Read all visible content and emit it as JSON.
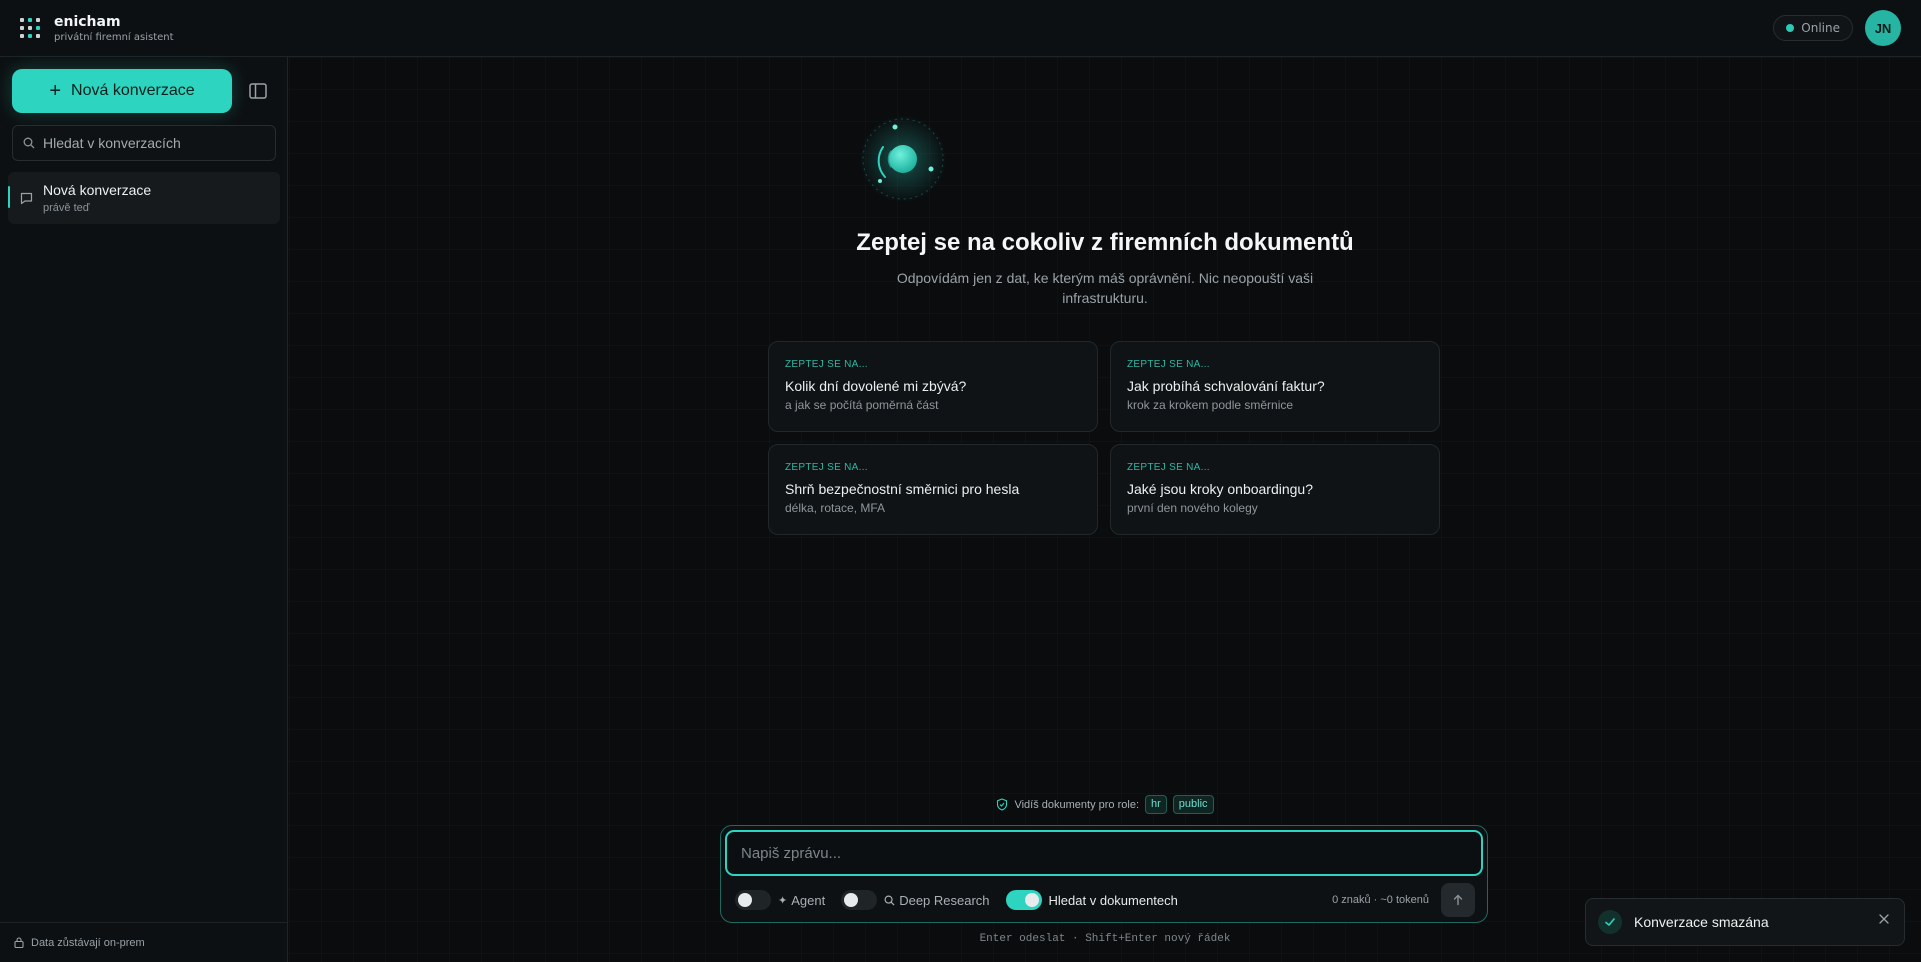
{
  "header": {
    "brand_name": "enicham",
    "brand_subtitle": "privátní firemní asistent",
    "status_label": "Online",
    "avatar_initials": "JN",
    "accent_color": "#2dd4bf"
  },
  "sidebar": {
    "new_conversation_label": "Nová konverzace",
    "search_placeholder": "Hledat v konverzacích",
    "conversations": [
      {
        "title": "Nová konverzace",
        "time": "právě teď"
      }
    ],
    "footer_text": "Data zůstávají on-prem"
  },
  "main": {
    "title": "Zeptej se na cokoliv z firemních dokumentů",
    "subtitle": "Odpovídám jen z dat, ke kterým máš oprávnění. Nic neopouští vaši infrastrukturu.",
    "suggestions": [
      {
        "kicker": "ZEPTEJ SE NA...",
        "title": "Kolik dní dovolené mi zbývá?",
        "sub": "a jak se počítá poměrná část"
      },
      {
        "kicker": "ZEPTEJ SE NA...",
        "title": "Jak probíhá schvalování faktur?",
        "sub": "krok za krokem podle směrnice"
      },
      {
        "kicker": "ZEPTEJ SE NA...",
        "title": "Shrň bezpečnostní směrnici pro hesla",
        "sub": "délka, rotace, MFA"
      },
      {
        "kicker": "ZEPTEJ SE NA...",
        "title": "Jaké jsou kroky onboardingu?",
        "sub": "první den nového kolegy"
      }
    ],
    "roles_label": "Vidíš dokumenty pro role:",
    "roles": [
      "hr",
      "public"
    ]
  },
  "composer": {
    "placeholder": "Napiš zprávu...",
    "value": "",
    "agent_label": "Agent",
    "agent_on": false,
    "deep_research_label": "Deep Research",
    "deep_research_on": false,
    "doc_search_label": "Hledat v dokumentech",
    "doc_search_on": true,
    "counter": "0 znaků · ~0 tokenů",
    "hint": "Enter odeslat · Shift+Enter nový řádek"
  },
  "toast": {
    "message": "Konverzace smazána"
  }
}
